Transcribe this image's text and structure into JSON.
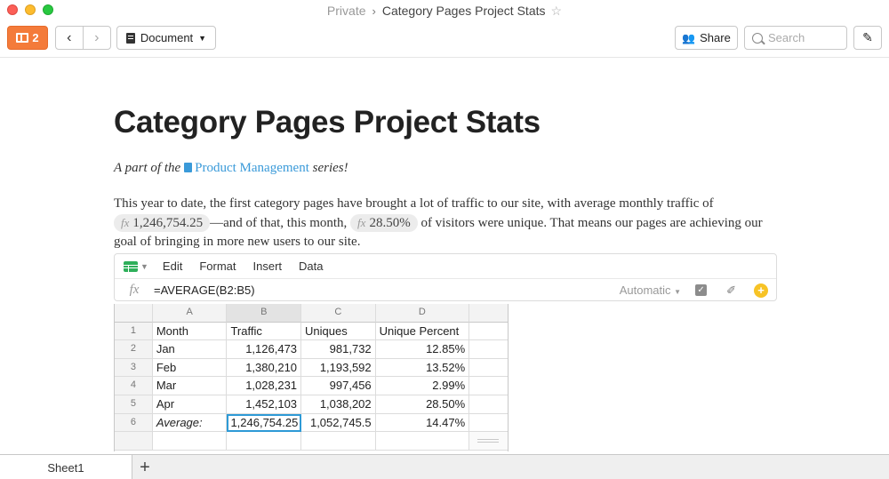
{
  "window": {
    "breadcrumb_parent": "Private",
    "breadcrumb_sep": "›",
    "title": "Category Pages Project Stats",
    "star_glyph": "☆"
  },
  "toolbar": {
    "sidebar_count": "2",
    "back_glyph": "‹",
    "forward_glyph": "›",
    "document_label": "Document",
    "share_label": "Share",
    "search_placeholder": "Search",
    "edit_glyph": "✎"
  },
  "doc": {
    "title": "Category Pages Project Stats",
    "series_prefix": "A part of the",
    "series_link": "Product Management",
    "series_suffix": "series!",
    "para_1": "This year to date, the first category pages have brought a lot of traffic to our site, with average monthly traffic of",
    "formula_1": "1,246,754.25",
    "para_2": "—and of that, this month,",
    "formula_2": "28.50%",
    "para_3": "of visitors were unique. That means our pages are achieving our goal of bringing in more new users to our site.",
    "fx_label": "fx"
  },
  "sheet_toolbar": {
    "menu": [
      "Edit",
      "Format",
      "Insert",
      "Data"
    ],
    "fx_label": "fx",
    "formula": "=AVERAGE(B2:B5)",
    "format_mode": "Automatic",
    "check_glyph": "✓",
    "brush_glyph": "✐",
    "plus_glyph": "+"
  },
  "grid": {
    "col_headers": [
      "A",
      "B",
      "C",
      "D"
    ],
    "rows": [
      {
        "n": "1",
        "a": "Month",
        "b": "Traffic",
        "c": "Uniques",
        "d": "Unique Percent"
      },
      {
        "n": "2",
        "a": "Jan",
        "b": "1,126,473",
        "c": "981,732",
        "d": "12.85%"
      },
      {
        "n": "3",
        "a": "Feb",
        "b": "1,380,210",
        "c": "1,193,592",
        "d": "13.52%"
      },
      {
        "n": "4",
        "a": "Mar",
        "b": "1,028,231",
        "c": "997,456",
        "d": "2.99%"
      },
      {
        "n": "5",
        "a": "Apr",
        "b": "1,452,103",
        "c": "1,038,202",
        "d": "28.50%"
      },
      {
        "n": "6",
        "a": "Average:",
        "b": "1,246,754.25",
        "c": "1,052,745.5",
        "d": "14.47%"
      }
    ]
  },
  "tabs": {
    "sheet_name": "Sheet1",
    "add_glyph": "+"
  },
  "colors": {
    "accent_orange": "#f47b3a",
    "link_blue": "#3a9ad9",
    "sheet_green": "#2eaf5a",
    "selection_blue": "#2e9ad6",
    "badge_yellow": "#f7c326"
  }
}
